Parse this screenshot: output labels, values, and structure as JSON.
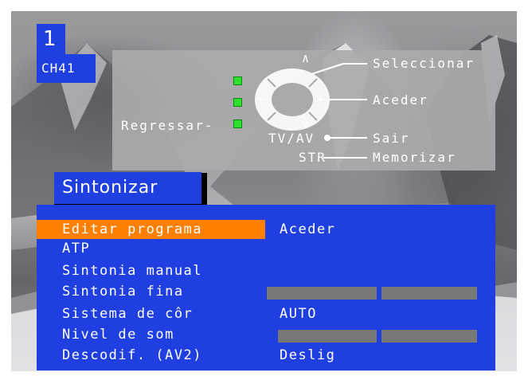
{
  "channel": {
    "number": "1",
    "name": "CH41"
  },
  "help": {
    "select": "Seleccionar",
    "access": "Aceder",
    "back": "Regressar-",
    "exit": "Sair",
    "memorize": "Memorizar",
    "tvav": "TV/AV",
    "str": "STR",
    "plus": "+",
    "minus": "−",
    "up": "∧",
    "down": "∨"
  },
  "menu": {
    "title": "Sintonizar",
    "items": [
      {
        "label": "Editar programa",
        "value": "Aceder",
        "selected": true
      },
      {
        "label": "ATP",
        "value": ""
      },
      {
        "label": "Sintonia manual",
        "value": ""
      },
      {
        "label": "Sintonia fina",
        "value": "",
        "bar": true
      },
      {
        "label": "Sistema de côr",
        "value": "AUTO"
      },
      {
        "label": "Nivel de som",
        "value": "",
        "bar": true
      },
      {
        "label": "Descodif. (AV2)",
        "value": "Deslig"
      }
    ]
  },
  "colors": {
    "menu_blue": "#1f3fe0",
    "highlight_orange": "#ff7f00",
    "led_green": "#2fe02f",
    "bar_gray": "#787878",
    "help_panel_gray": "#aaaaac"
  }
}
